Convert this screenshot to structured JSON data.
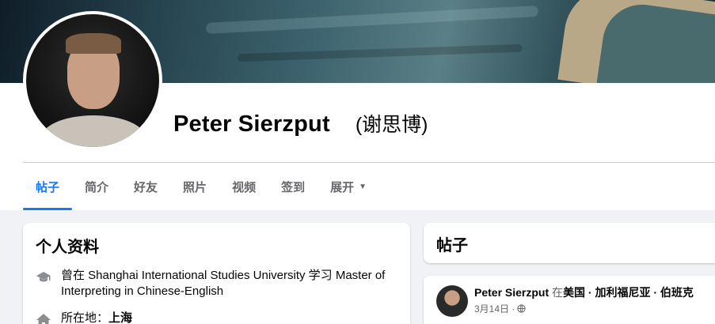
{
  "profile": {
    "name": "Peter Sierzput",
    "alt_name": "(谢思博)"
  },
  "tabs": [
    {
      "label": "帖子",
      "active": true
    },
    {
      "label": "简介"
    },
    {
      "label": "好友"
    },
    {
      "label": "照片"
    },
    {
      "label": "视频"
    },
    {
      "label": "签到"
    },
    {
      "label": "展开"
    }
  ],
  "intro": {
    "title": "个人资料",
    "education": "曾在 Shanghai International Studies University 学习 Master of Interpreting in Chinese-English",
    "location_label": "所在地：",
    "location_value": "上海"
  },
  "posts": {
    "title": "帖子",
    "first_post": {
      "author": "Peter Sierzput",
      "in_word": "在",
      "place": "美国 · 加利福尼亚 · 伯班克",
      "date": "3月14日 ·"
    }
  },
  "colors": {
    "accent": "#1877f2",
    "background": "#f0f2f5",
    "secondary_text": "#65676b"
  },
  "icons": {
    "education": "graduation-cap-icon",
    "location": "home-icon",
    "privacy": "globe-icon",
    "more": "caret-down-icon"
  }
}
